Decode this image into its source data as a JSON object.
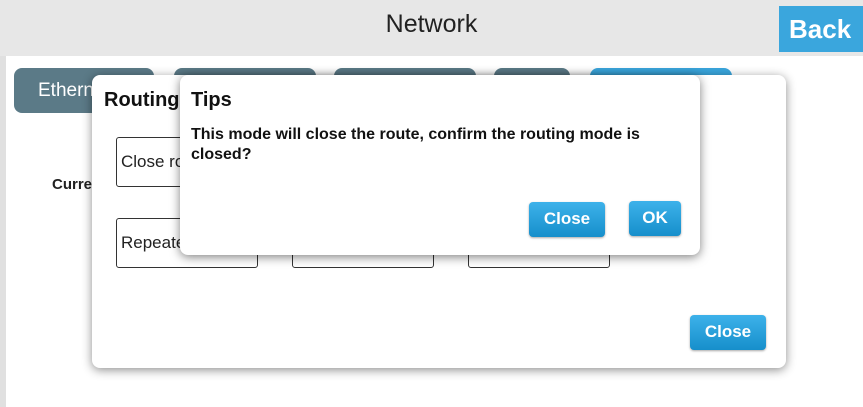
{
  "header": {
    "title": "Network",
    "back_label": "Back"
  },
  "tabs": [
    {
      "label": "Ethernet"
    },
    {
      "label": ""
    },
    {
      "label": ""
    },
    {
      "label": ""
    },
    {
      "label": ""
    }
  ],
  "main": {
    "current_label": "Current"
  },
  "routing_dialog": {
    "title": "Routing",
    "options": [
      {
        "label": "Close routing"
      },
      {
        "label": "Repeater"
      },
      {
        "label": ""
      },
      {
        "label": ""
      }
    ],
    "close_label": "Close"
  },
  "tips_dialog": {
    "title": "Tips",
    "message": "This mode will close the route, confirm the routing mode is closed?",
    "close_label": "Close",
    "ok_label": "OK"
  },
  "colors": {
    "accent": "#3aa6dd",
    "button": "#1e9ad6",
    "tab_inactive": "#5b7a87",
    "header_bg": "#e7e7e7"
  }
}
